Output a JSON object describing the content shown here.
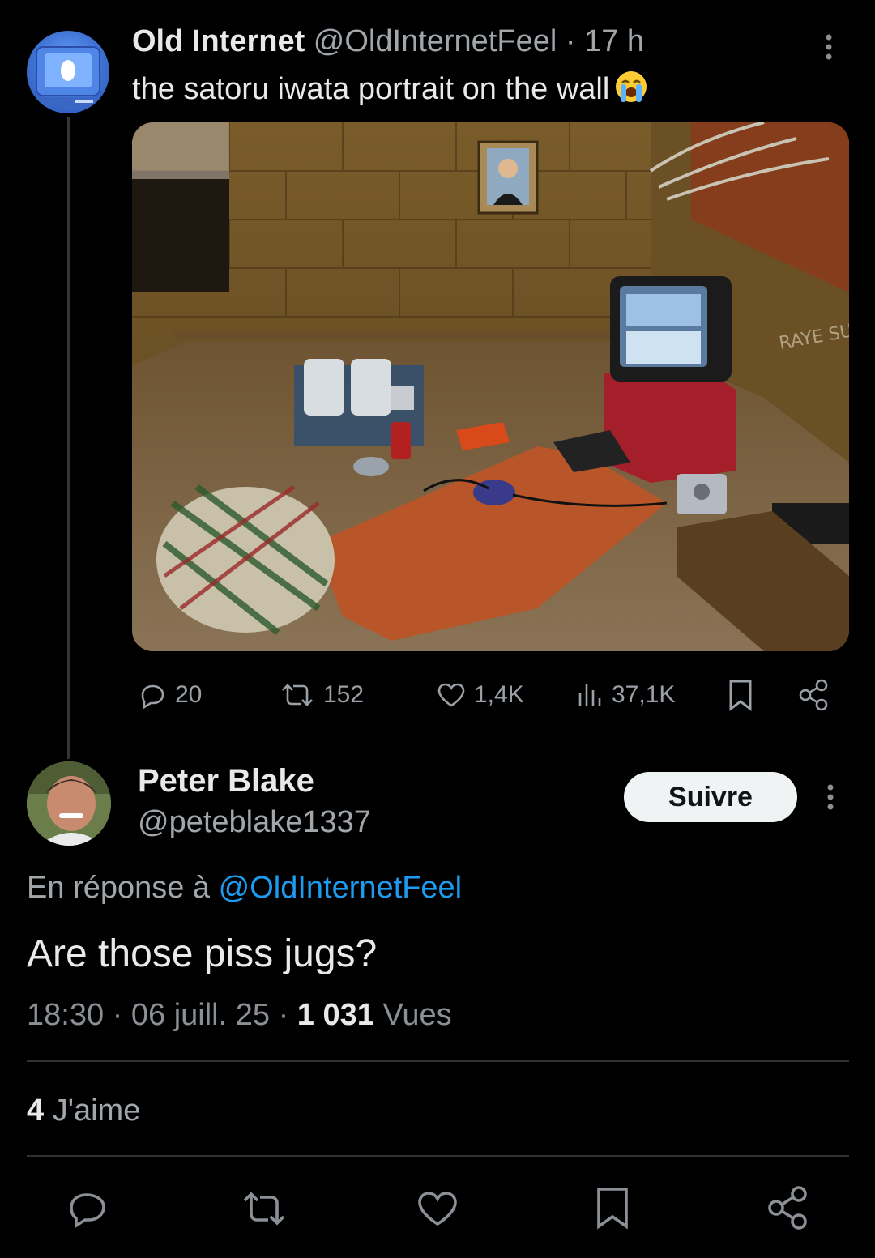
{
  "tweet": {
    "author_name": "Old Internet",
    "author_handle": "@OldInternetFeel",
    "separator": "·",
    "time": "17 h",
    "text": "the satoru iwata portrait on the wall",
    "emoji": "loudly-crying-face",
    "media_graffiti": "RAYE SUX!",
    "stats": {
      "replies": "20",
      "retweets": "152",
      "likes": "1,4K",
      "views": "37,1K"
    }
  },
  "reply": {
    "author_name": "Peter Blake",
    "author_handle": "@peteblake1337",
    "follow_label": "Suivre",
    "in_reply_prefix": "En réponse à",
    "in_reply_mention": "@OldInternetFeel",
    "text": "Are those piss jugs?",
    "time": "18:30",
    "date": "06 juill. 25",
    "separator": "·",
    "views_count": "1 031",
    "views_label": "Vues",
    "likes_count": "4",
    "likes_label": "J'aime"
  },
  "icons": {
    "reply": "reply-icon",
    "retweet": "retweet-icon",
    "like": "heart-icon",
    "views": "views-chart-icon",
    "bookmark": "bookmark-icon",
    "share": "share-icon",
    "more": "more-vertical-icon"
  },
  "colors": {
    "background": "#000000",
    "text": "#e7e9ea",
    "muted": "#8b9096",
    "link": "#1d9bf0",
    "divider": "#2f3336"
  }
}
